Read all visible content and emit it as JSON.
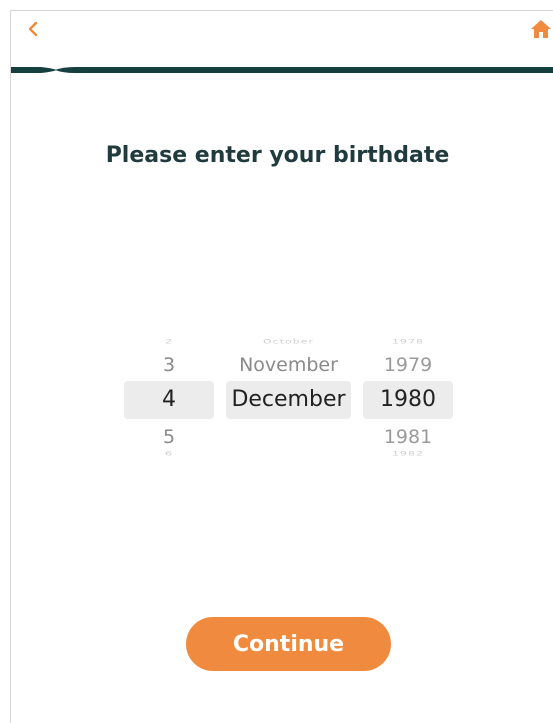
{
  "header": {
    "back_icon": "chevron-left-icon",
    "home_icon": "home-icon",
    "accent_color": "#f08a3e",
    "progress_color": "#163f3f"
  },
  "title": "Please enter your birthdate",
  "picker": {
    "day": {
      "options": [
        "2",
        "3",
        "4",
        "5",
        "6"
      ],
      "selected": "4"
    },
    "month": {
      "options": [
        "October",
        "November",
        "December"
      ],
      "selected": "December"
    },
    "year": {
      "options": [
        "1978",
        "1979",
        "1980",
        "1981",
        "1982"
      ],
      "selected": "1980"
    }
  },
  "continue_label": "Continue",
  "colors": {
    "title": "#1f3b3d",
    "button": "#f08a3e",
    "selection_bg": "#ececec"
  }
}
